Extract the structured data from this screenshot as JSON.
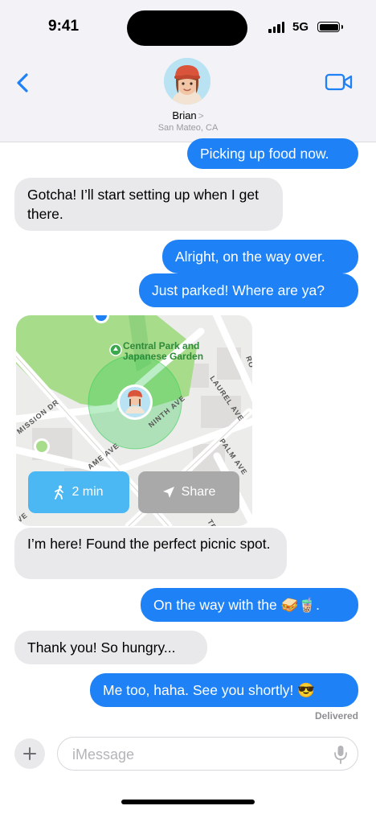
{
  "status_bar": {
    "time": "9:41",
    "network": "5G"
  },
  "header": {
    "contact_name": "Brian",
    "contact_chevron": ">",
    "location": "San Mateo, CA"
  },
  "messages": [
    {
      "from": "me",
      "text": "Picking up food now."
    },
    {
      "from": "them",
      "text": "Gotcha! I’ll start setting up when I get there."
    },
    {
      "from": "me",
      "text": "Alright, on the way over."
    },
    {
      "from": "me",
      "text": "Just parked! Where are ya?"
    },
    {
      "from": "them",
      "text": "I’m here! Found the perfect picnic spot."
    },
    {
      "from": "me",
      "text": "On the way with the 🥪🧋."
    },
    {
      "from": "them",
      "text": "Thank you! So hungry..."
    },
    {
      "from": "me",
      "text": "Me too, haha. See you shortly! 😎"
    }
  ],
  "map_card": {
    "park_label_1": "Central Park and",
    "park_label_2": "Japanese Garden",
    "streets": [
      "MISSION DR",
      "NINTH AVE",
      "LAUREL AVE",
      "PALM AVE",
      "AME AVE",
      "RO",
      "TE",
      "VE"
    ],
    "walk_button": "2 min",
    "share_button": "Share",
    "colors": {
      "park": "#a6dc8a",
      "location_halo": "#3ccf5c",
      "walk_button": "#4cb8f3",
      "share_button": "#a9a9a9"
    }
  },
  "delivery_status": "Delivered",
  "composer": {
    "placeholder": "iMessage"
  },
  "icons": [
    "back-chevron-icon",
    "video-camera-icon",
    "plus-icon",
    "microphone-icon",
    "walking-person-icon",
    "location-arrow-icon",
    "park-pin-icon"
  ],
  "colors": {
    "outgoing_bubble": "#1e82f6",
    "incoming_bubble": "#e9e9eb",
    "accent": "#1e82f6"
  }
}
